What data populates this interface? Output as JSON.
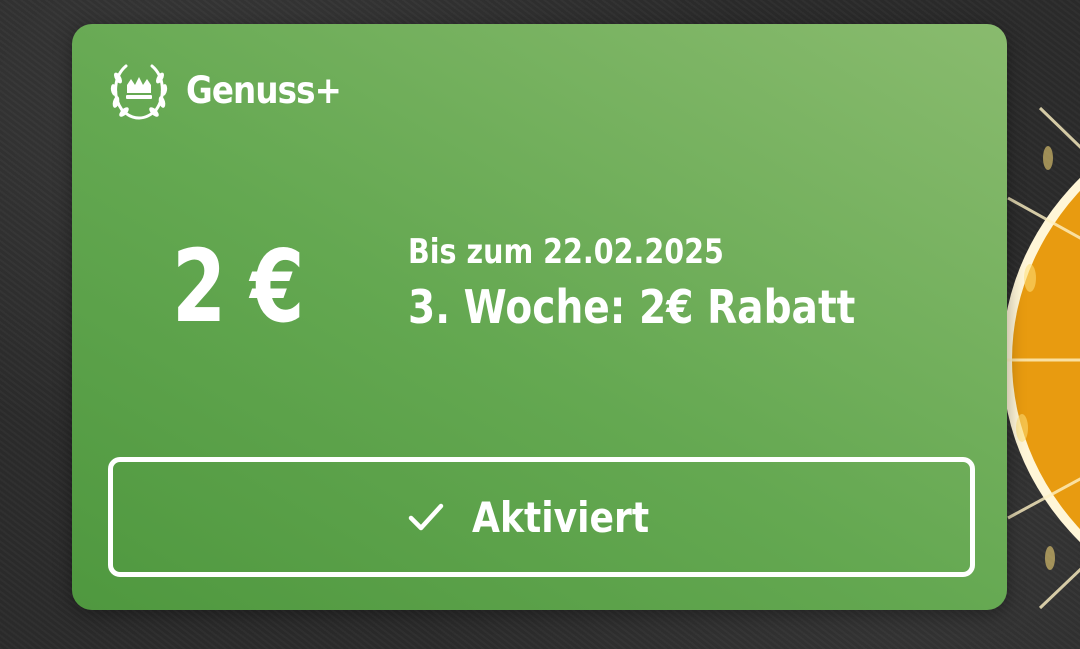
{
  "card": {
    "brand": "Genuss+",
    "amount": "2 €",
    "valid_until": "Bis zum 22.02.2025",
    "description": "3. Woche: 2€ Rabatt",
    "button_label": "Aktiviert"
  },
  "icons": {
    "brand_logo": "laurel-crown-icon",
    "button": "checkmark-icon"
  },
  "colors": {
    "card_green_dark": "#4f983f",
    "card_green_light": "#89bb6e",
    "text": "#ffffff",
    "background": "#2b2b2b",
    "orange": "#f5b625"
  }
}
